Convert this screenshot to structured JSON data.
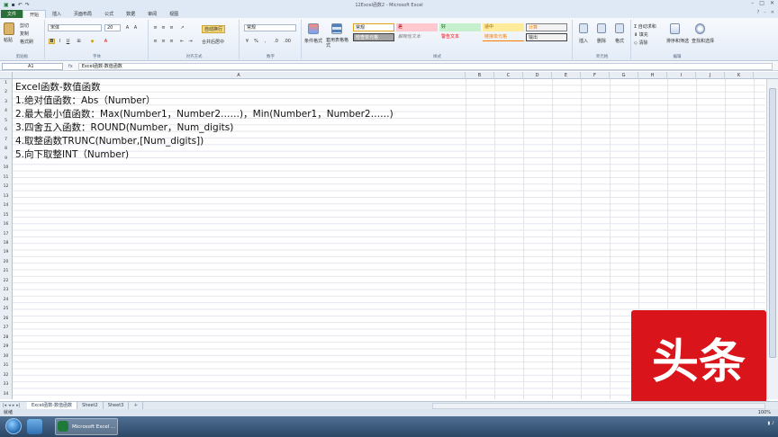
{
  "window": {
    "title": "12Excel函数2 - Microsoft Excel"
  },
  "tabs": [
    {
      "label": "文件"
    },
    {
      "label": "开始"
    },
    {
      "label": "插入"
    },
    {
      "label": "页面布局"
    },
    {
      "label": "公式"
    },
    {
      "label": "数据"
    },
    {
      "label": "审阅"
    },
    {
      "label": "视图"
    }
  ],
  "ribbon": {
    "clipboard": {
      "paste": "粘贴",
      "cut": "剪切",
      "copy": "复制",
      "format_painter": "格式刷",
      "group": "剪贴板"
    },
    "font": {
      "name": "宋体",
      "size": "20",
      "group": "字体"
    },
    "alignment": {
      "wrap": "自动换行",
      "merge": "合并后居中",
      "group": "对齐方式"
    },
    "number": {
      "format": "常规",
      "group": "数字"
    },
    "styles": {
      "conditional": "条件格式",
      "table": "套用表格格式",
      "cells": [
        {
          "label": "常规",
          "bg": "#ffffff",
          "fg": "#000000"
        },
        {
          "label": "差",
          "bg": "#ffc7ce",
          "fg": "#9c0006"
        },
        {
          "label": "好",
          "bg": "#c6efce",
          "fg": "#006100"
        },
        {
          "label": "适中",
          "bg": "#ffeb9c",
          "fg": "#9c6500"
        },
        {
          "label": "计算",
          "bg": "#f2f2f2",
          "fg": "#fa7d00"
        },
        {
          "label": "检查单元格",
          "bg": "#a5a5a5",
          "fg": "#ffffff"
        },
        {
          "label": "解释性文本",
          "bg": "#ffffff",
          "fg": "#7f7f7f"
        },
        {
          "label": "警告文本",
          "bg": "#ffffff",
          "fg": "#ff0000"
        },
        {
          "label": "链接单元格",
          "bg": "#ffffff",
          "fg": "#fa7d00"
        },
        {
          "label": "输出",
          "bg": "#f2f2f2",
          "fg": "#3f3f3f"
        }
      ],
      "group": "样式"
    },
    "cells": {
      "insert": "插入",
      "delete": "删除",
      "format": "格式",
      "group": "单元格"
    },
    "editing": {
      "autosum": "自动求和",
      "fill": "填充",
      "clear": "清除",
      "sort": "排序和筛选",
      "find": "查找和选择",
      "group": "编辑"
    }
  },
  "formula_bar": {
    "name_box": "A1",
    "fx": "fx",
    "content": "Excel函数-数值函数"
  },
  "columns": [
    "A",
    "B",
    "C",
    "D",
    "E",
    "F",
    "G",
    "H",
    "I",
    "J",
    "K"
  ],
  "rows": [
    "1",
    "2",
    "3",
    "4",
    "5",
    "6",
    "7",
    "8",
    "9",
    "10",
    "11",
    "12",
    "13",
    "14",
    "15",
    "16",
    "17",
    "18",
    "19",
    "20",
    "21",
    "22",
    "23",
    "24",
    "25",
    "26",
    "27",
    "28",
    "29",
    "30",
    "31",
    "32",
    "33",
    "34"
  ],
  "content": {
    "lines": [
      "Excel函数-数值函数",
      "1.绝对值函数：Abs（Number）",
      "2.最大最小值函数：Max(Number1，Number2……)，Min(Number1，Number2……)",
      "3.四舍五入函数：ROUND(Number，Num_digits)",
      "4.取整函数TRUNC(Number,[Num_digits])",
      "5.向下取整INT（Number)"
    ]
  },
  "sheets": [
    {
      "label": "Excel函数-数值函数"
    },
    {
      "label": "Sheet2"
    },
    {
      "label": "Sheet3"
    }
  ],
  "status": {
    "ready": "就绪",
    "zoom": "100%"
  },
  "taskbar": {
    "task": "Microsoft Excel ..."
  },
  "watermark": {
    "text": "头条"
  }
}
